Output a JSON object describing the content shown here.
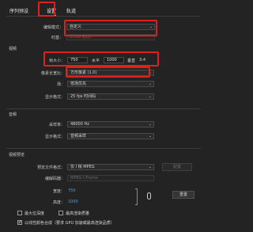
{
  "tabs": [
    {
      "label": "序列预设"
    },
    {
      "label": "设置"
    },
    {
      "label": "轨道"
    }
  ],
  "general": {
    "editing_mode_label": "编辑模式：",
    "editing_mode_value": "自定义",
    "timebase_label": "时基：",
    "timebase_value": "25.00 帧/秒"
  },
  "video": {
    "section_title": "视频",
    "frame_size_label": "帧大小：",
    "frame_width": "750",
    "horizontal_label": "水平",
    "frame_height": "1000",
    "vertical_label": "垂直",
    "aspect_ratio": "3:4",
    "pixel_aspect_label": "像素长宽比：",
    "pixel_aspect_value": "方形像素 (1.0)",
    "fields_label": "场：",
    "fields_value": "低场优先",
    "display_format_label": "显示格式：",
    "display_format_value": "25 fps 时间码"
  },
  "audio": {
    "section_title": "音频",
    "sample_rate_label": "采样率：",
    "sample_rate_value": "48000 Hz",
    "display_format_label": "显示格式：",
    "display_format_value": "音频采样"
  },
  "preview": {
    "section_title": "视频预览",
    "file_format_label": "预览文件格式：",
    "file_format_value": "仅 I 帧 MPEG",
    "configure_label": "配置",
    "codec_label": "编解码器：",
    "codec_value": "MPEG I-Frame",
    "width_label": "宽度：",
    "width_value": "750",
    "height_label": "高度：",
    "height_value": "1000",
    "reset_label": "重置"
  },
  "options": {
    "max_bit_depth": "最大位深度",
    "max_render_quality": "最高渲染质量",
    "linear_color": "以线性颜色合成（要求 GPU 加速或最高渲染品质）"
  },
  "colors": {
    "background": "#232323",
    "highlight_box": "#e0201a",
    "link_blue": "#4f9ee8"
  }
}
